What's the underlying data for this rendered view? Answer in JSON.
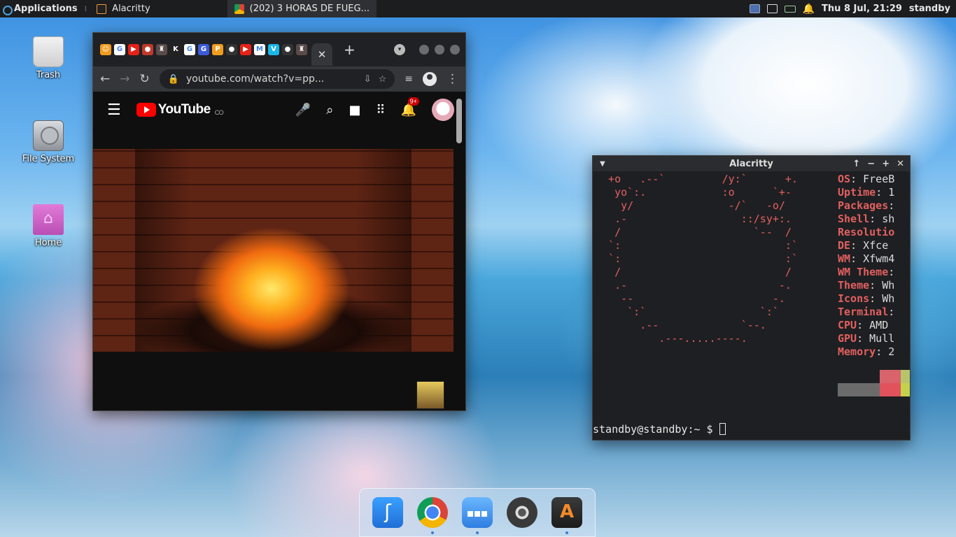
{
  "top_panel": {
    "applications_label": "Applications",
    "tasks": [
      {
        "label": "Alacritty"
      },
      {
        "label": "(202) 3 HORAS DE FUEG..."
      }
    ],
    "clock": "Thu  8 Jul, 21:29",
    "user": "standby"
  },
  "desktop": {
    "icons": [
      {
        "label": "Trash",
        "icon": "trash-icon"
      },
      {
        "label": "File System",
        "icon": "hard-drive-icon"
      },
      {
        "label": "Home",
        "icon": "home-folder-icon"
      }
    ]
  },
  "chrome": {
    "new_tab_label": "+",
    "close_tab_label": "✕",
    "url": "youtube.com/watch?v=pp...",
    "favicons": [
      {
        "color": "#f29c1f",
        "glyph": "☺"
      },
      {
        "color": "#ffffff",
        "glyph": "G"
      },
      {
        "color": "#e62117",
        "glyph": "▶"
      },
      {
        "color": "#c0392b",
        "glyph": "●"
      },
      {
        "color": "#5a4a4a",
        "glyph": "♜"
      },
      {
        "color": "#222222",
        "glyph": "K"
      },
      {
        "color": "#ffffff",
        "glyph": "G"
      },
      {
        "color": "#3b5bdb",
        "glyph": "G"
      },
      {
        "color": "#f29c1f",
        "glyph": "P"
      },
      {
        "color": "#333333",
        "glyph": "●"
      },
      {
        "color": "#e62117",
        "glyph": "▶"
      },
      {
        "color": "#ffffff",
        "glyph": "M"
      },
      {
        "color": "#1ab7ea",
        "glyph": "V"
      },
      {
        "color": "#333333",
        "glyph": "●"
      },
      {
        "color": "#5a4a4a",
        "glyph": "♜"
      }
    ]
  },
  "youtube": {
    "logo_text": "YouTube",
    "country_code": "CO",
    "notification_count": "9+"
  },
  "alacritty": {
    "title": "Alacritty",
    "ascii_lines": [
      "  +o   .--`         /y:`      +.",
      "   yo`:.            :o      `+-",
      "    y/               -/`   -o/",
      "   .-                  ::/sy+:.",
      "   /                     `--  /",
      "  `:                          :`",
      "  `:                          :`",
      "   /                          /",
      "   .-                        -.",
      "    --                      -.",
      "     `:`                  `:`",
      "       .--             `--.",
      "          .---.....----."
    ],
    "info": [
      {
        "key": "OS",
        "value": ": FreeB"
      },
      {
        "key": "Uptime",
        "value": ": 1"
      },
      {
        "key": "Packages",
        "value": ":"
      },
      {
        "key": "Shell",
        "value": ": sh"
      },
      {
        "key": "Resolutio",
        "value": ""
      },
      {
        "key": "DE",
        "value": ": Xfce"
      },
      {
        "key": "WM",
        "value": ": Xfwm4"
      },
      {
        "key": "WM Theme",
        "value": ":"
      },
      {
        "key": "Theme",
        "value": ": Wh"
      },
      {
        "key": "Icons",
        "value": ": Wh"
      },
      {
        "key": "Terminal",
        "value": ":"
      },
      {
        "key": "CPU",
        "value": ": AMD"
      },
      {
        "key": "GPU",
        "value": ": Mull"
      },
      {
        "key": "Memory",
        "value": ": 2"
      }
    ],
    "palette_top": [
      "#1e1f22",
      "#1e1f22",
      "#d9636b",
      "#b8c46a",
      "#e0e0e0"
    ],
    "palette_bottom": [
      "#6b6b6b",
      "#6b6b6b",
      "#e0525c",
      "#c3d24a",
      "#f2f2f2"
    ],
    "prompt": "standby@standby:~ $ "
  },
  "dock": {
    "items": [
      {
        "name": "text-editor-icon"
      },
      {
        "name": "chrome-icon"
      },
      {
        "name": "file-manager-icon"
      },
      {
        "name": "settings-icon"
      },
      {
        "name": "alacritty-icon"
      }
    ]
  }
}
